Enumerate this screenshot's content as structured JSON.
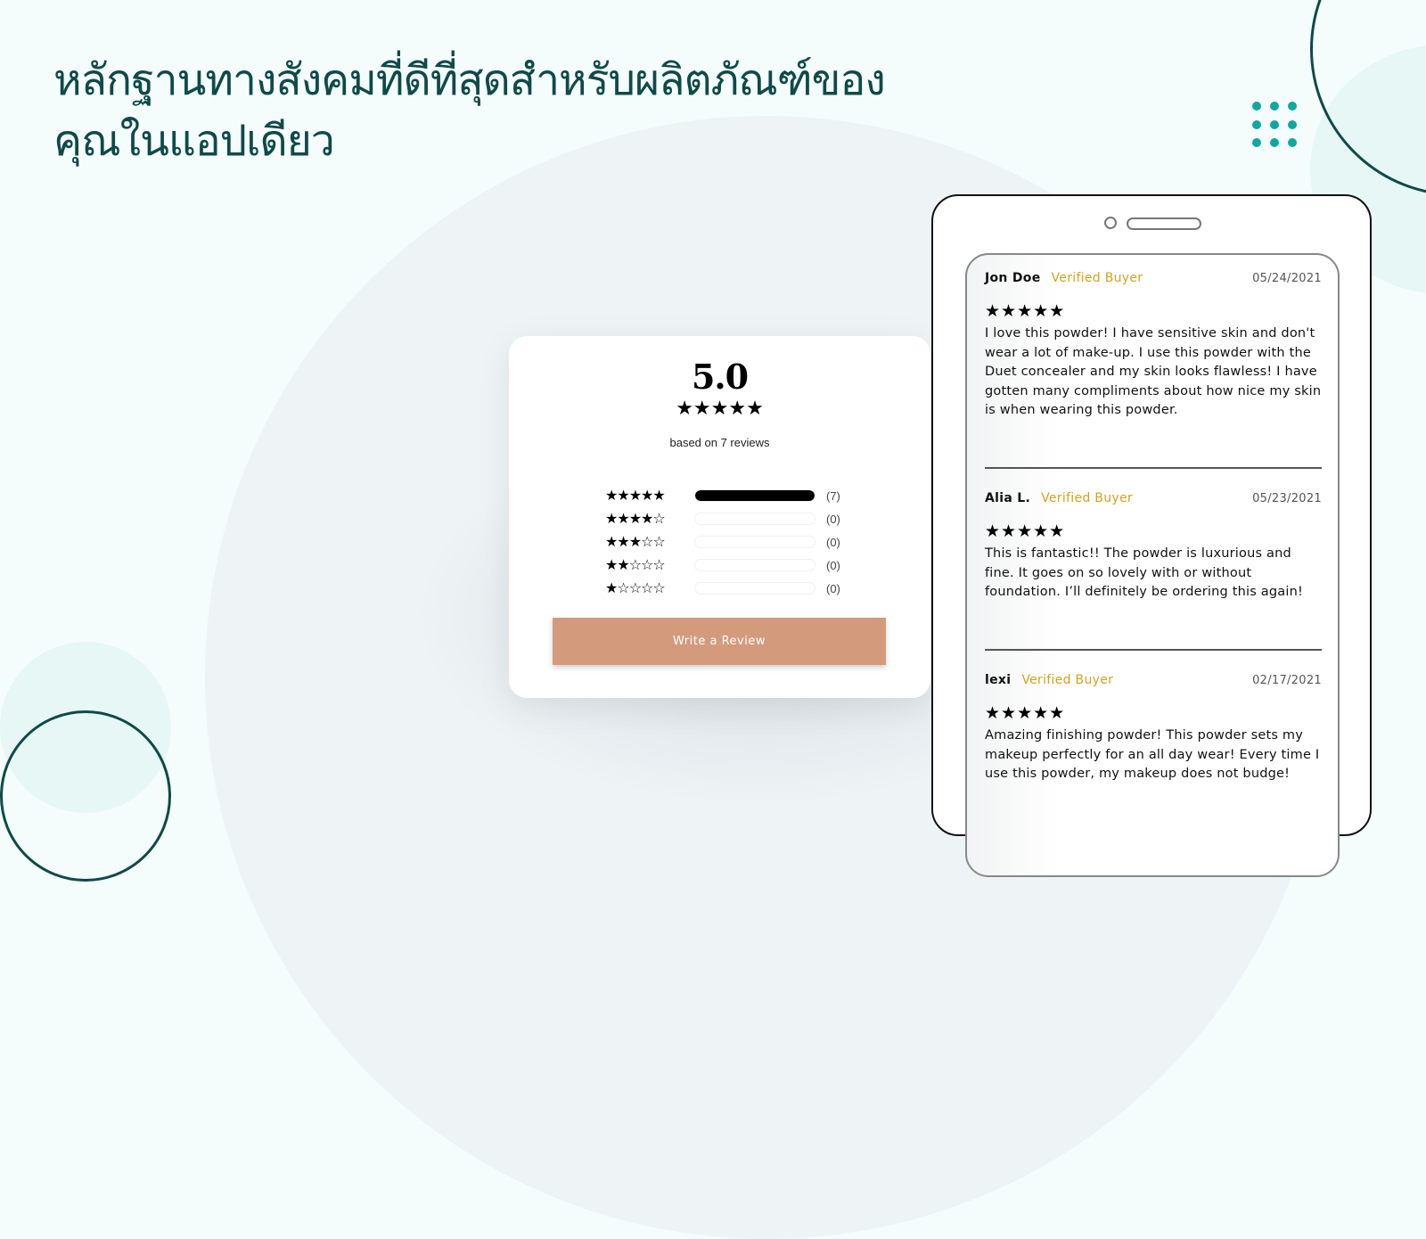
{
  "headline": "หลักฐานทางสังคมที่ดีที่สุดสำหรับผลิตภัณฑ์ของคุณในแอปเดียว",
  "summary": {
    "average": "5.0",
    "average_stars": "★★★★★",
    "based_on": "based on 7 reviews",
    "histogram": [
      {
        "stars": "★★★★★",
        "count_label": "(7)",
        "fraction": 1.0
      },
      {
        "stars": "★★★★☆",
        "count_label": "(0)",
        "fraction": 0
      },
      {
        "stars": "★★★☆☆",
        "count_label": "(0)",
        "fraction": 0
      },
      {
        "stars": "★★☆☆☆",
        "count_label": "(0)",
        "fraction": 0
      },
      {
        "stars": "★☆☆☆☆",
        "count_label": "(0)",
        "fraction": 0
      }
    ],
    "write_review_label": "Write a Review",
    "button_color": "#d39b7c"
  },
  "reviews": [
    {
      "name": "Jon Doe",
      "badge": "Verified Buyer",
      "date": "05/24/2021",
      "stars": "★★★★★",
      "body": "I love this powder! I have sensitive skin and don't wear a lot of make-up. I use this powder with the Duet concealer and my skin looks flawless! I have gotten many compliments about how nice my skin is when wearing this powder."
    },
    {
      "name": "Alia L.",
      "badge": "Verified Buyer",
      "date": "05/23/2021",
      "stars": "★★★★★",
      "body": "This is fantastic!! The powder is luxurious and fine. It goes on so lovely with or without foundation. I’ll definitely be ordering this again!"
    },
    {
      "name": "lexi",
      "badge": "Verified Buyer",
      "date": "02/17/2021",
      "stars": "★★★★★",
      "body": "Amazing finishing powder! This powder sets my makeup perfectly for an all day wear! Every time I use this powder, my makeup does not budge!"
    }
  ],
  "colors": {
    "headline": "#0e4a48",
    "accent_teal": "#0fa7a0",
    "verified": "#d4a21d"
  }
}
